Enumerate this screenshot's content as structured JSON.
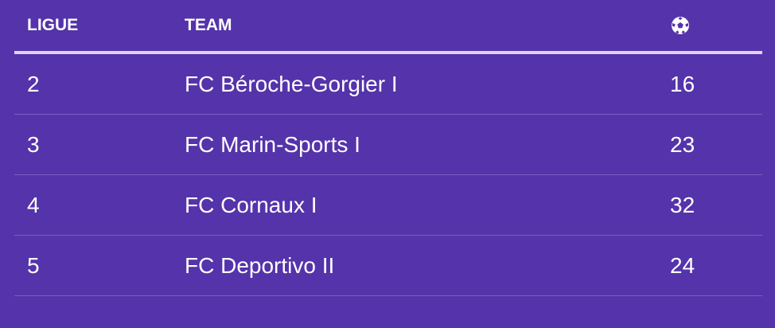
{
  "table": {
    "columns": {
      "ligue": "LIGUE",
      "team": "TEAM",
      "goals_icon": "soccer-ball-icon"
    },
    "rows": [
      {
        "ligue": "2",
        "team": "FC Béroche-Gorgier I",
        "goals": "16"
      },
      {
        "ligue": "3",
        "team": "FC Marin-Sports I",
        "goals": "23"
      },
      {
        "ligue": "4",
        "team": "FC Cornaux I",
        "goals": "32"
      },
      {
        "ligue": "5",
        "team": "FC Deportivo II",
        "goals": "24"
      }
    ]
  },
  "colors": {
    "background": "#5533aa",
    "header_rule": "#dcd4ee",
    "row_divider": "#7a5fc0",
    "text": "#ffffff"
  }
}
